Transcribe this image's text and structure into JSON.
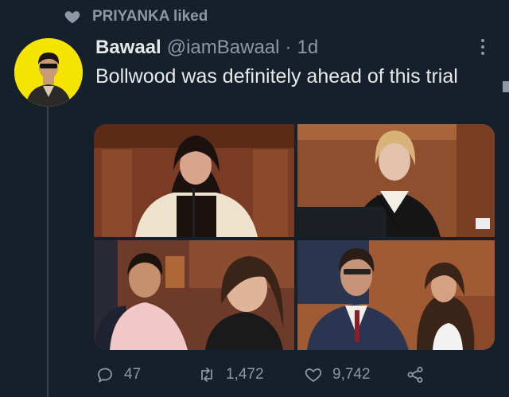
{
  "social_context": {
    "icon": "heart-icon",
    "text": "PRIYANKA liked"
  },
  "tweet": {
    "author_name": "Bawaal",
    "handle": "@iamBawaal",
    "separator": "·",
    "time": "1d",
    "text": "Bollwood was definitely ahead of this trial",
    "media": [
      {
        "name": "photo-woman-crying-court-film"
      },
      {
        "name": "photo-woman-testifying-court"
      },
      {
        "name": "photo-courtroom-film-scene"
      },
      {
        "name": "photo-man-courtroom"
      }
    ],
    "actions": {
      "reply_count": "47",
      "retweet_count": "1,472",
      "like_count": "9,742"
    }
  },
  "colors": {
    "background": "#15202b",
    "secondary_text": "#8b98a5",
    "avatar_bg": "#f5e400"
  }
}
